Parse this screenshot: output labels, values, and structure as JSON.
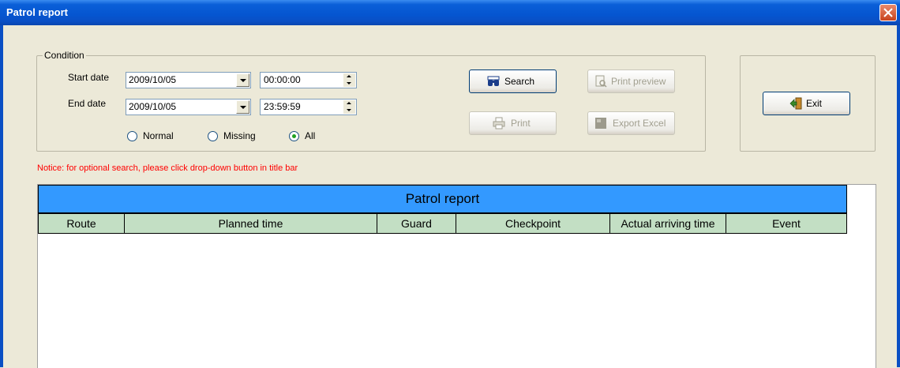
{
  "window": {
    "title": "Patrol report"
  },
  "condition": {
    "legend": "Condition",
    "start_label": "Start date",
    "end_label": "End date",
    "start_date_selected": "2009",
    "start_date_rest": "/10/05",
    "start_time": "00:00:00",
    "end_date": "2009/10/05",
    "end_time": "23:59:59",
    "radios": [
      {
        "label": "Normal",
        "checked": false
      },
      {
        "label": "Missing",
        "checked": false
      },
      {
        "label": "All",
        "checked": true
      }
    ]
  },
  "buttons": {
    "search": "Search",
    "print_preview": "Print preview",
    "print": "Print",
    "export_excel": "Export Excel",
    "exit": "Exit"
  },
  "notice": "Notice: for optional search, please click drop-down button in title bar",
  "report": {
    "title": "Patrol report",
    "columns": [
      "Route",
      "Planned time",
      "Guard",
      "Checkpoint",
      "Actual arriving time",
      "Event"
    ],
    "rows": []
  },
  "colors": {
    "report_title_bg": "#3399ff",
    "header_bg": "#c3dfc4",
    "notice": "#ff0000",
    "selection": "#00ffff"
  },
  "icons": {
    "search": "binoculars-icon",
    "print_preview": "print-preview-icon",
    "print": "printer-icon",
    "export_excel": "excel-icon",
    "exit": "exit-door-icon",
    "close": "close-icon"
  }
}
